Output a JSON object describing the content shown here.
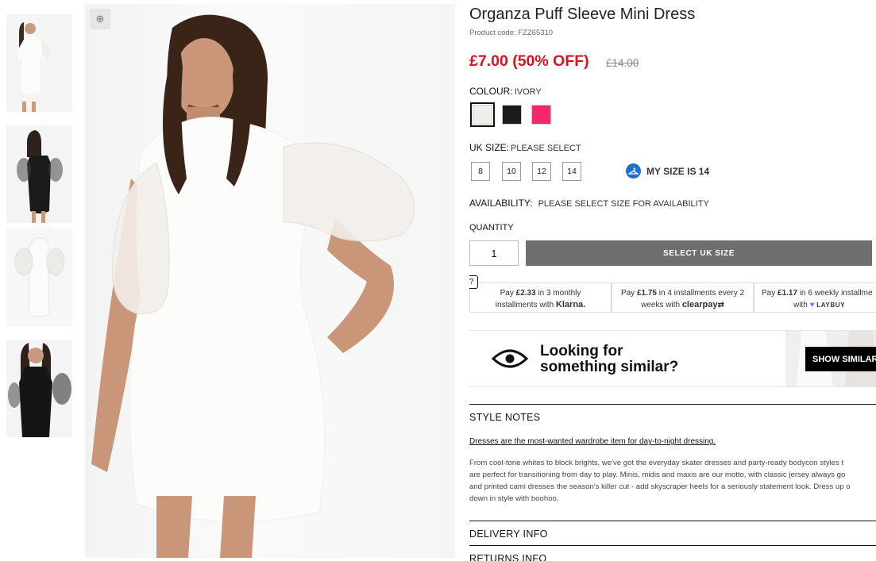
{
  "thumbnails": [
    {
      "label": "thumbnail-front"
    },
    {
      "label": "thumbnail-back"
    },
    {
      "label": "thumbnail-flat"
    },
    {
      "label": "thumbnail-black-close"
    }
  ],
  "zoom_icon": "zoom-in-icon",
  "product": {
    "title": "Organza Puff Sleeve Mini Dress",
    "code": "Product code: FZZ65310",
    "price": "£7.00 (50% OFF)",
    "was_price": "£14.00"
  },
  "colour": {
    "label": "COLOUR:",
    "value": "IVORY",
    "swatches": [
      {
        "name": "Ivory",
        "hex": "#f1efec",
        "selected": true
      },
      {
        "name": "Black",
        "hex": "#1b1b1b",
        "selected": false
      },
      {
        "name": "Pink",
        "hex": "#f2286b",
        "selected": false
      }
    ]
  },
  "size": {
    "label": "UK SIZE:",
    "value": "PLEASE SELECT",
    "options": [
      "8",
      "10",
      "12",
      "14"
    ],
    "my_size": "MY SIZE IS 14"
  },
  "availability": {
    "label": "AVAILABILITY:",
    "value": "PLEASE SELECT SIZE FOR AVAILABILITY"
  },
  "quantity": {
    "label": "QUANTITY",
    "value": "1"
  },
  "add_button": "SELECT UK SIZE",
  "help_mark": "?",
  "payment": [
    {
      "pre": "Pay ",
      "amount": "£2.33",
      "mid": " in 3 monthly",
      "line2": "installments with ",
      "brand": "Klarna."
    },
    {
      "pre": "Pay ",
      "amount": "£1.75",
      "mid": " in 4 installments every 2",
      "line2": "weeks with ",
      "brand": "clearpay"
    },
    {
      "pre": "Pay ",
      "amount": "£1.17",
      "mid": " in 6 weekly installme",
      "line2": "with ",
      "brand": "LAYBUY"
    }
  ],
  "similar": {
    "line1": "Looking for",
    "line2": "something similar?",
    "button": "SHOW SIMILAR"
  },
  "sections": {
    "style_notes": "STYLE NOTES",
    "delivery": "DELIVERY INFO",
    "returns": "RETURNS INFO"
  },
  "style_notes": {
    "heading": "Dresses are the most-wanted wardrobe item for day-to-night dressing.",
    "lines": [
      "From cool-tone whites to block brights, we've got the everyday skater dresses and party-ready bodycon styles t",
      "are perfect for transitioning from day to play. Minis, midis and maxis are our motto, with classic jersey always go",
      "and printed cami dresses the season's killer cut - add skyscraper heels for a seriously statement look. Dress up o",
      "down in style with boohoo."
    ]
  },
  "colors": {
    "price_red": "#e0101e",
    "button_grey": "#6f6f6f",
    "size_blue": "#1e6fcf"
  }
}
